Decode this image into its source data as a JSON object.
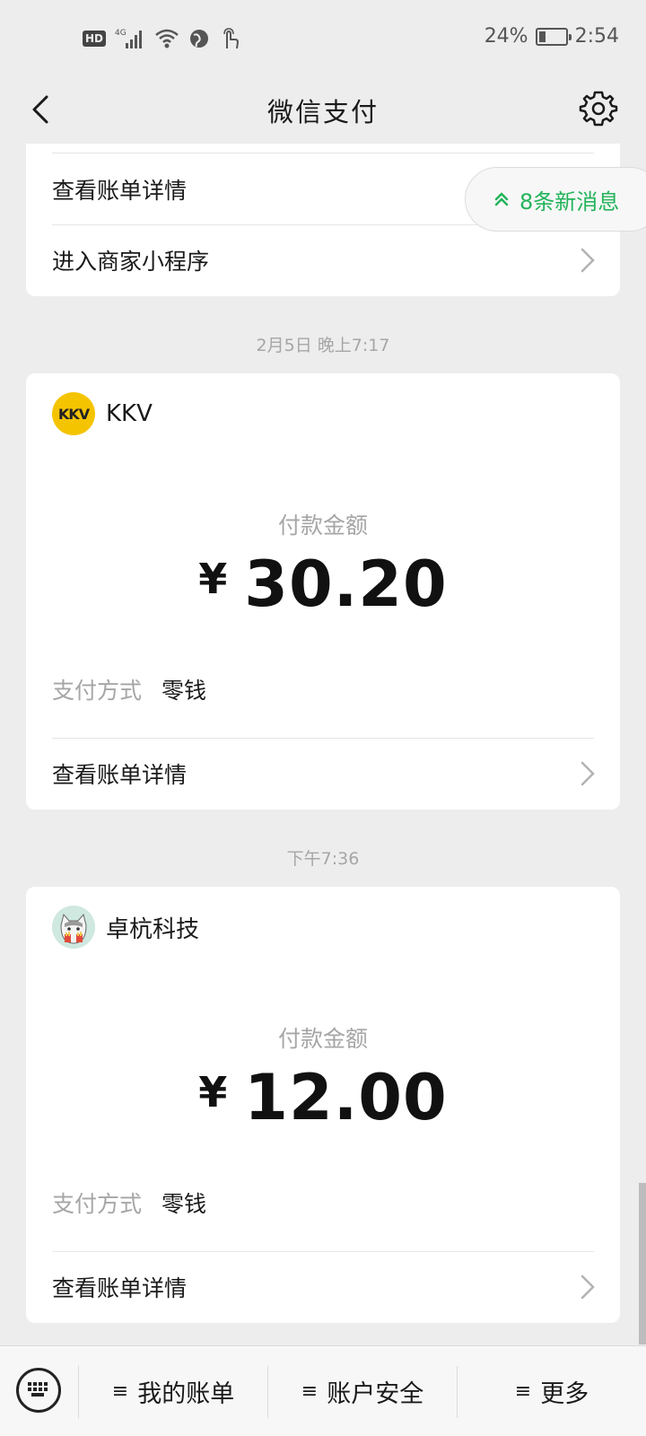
{
  "status_bar": {
    "hd": "HD",
    "network": "4G",
    "battery_text": "24%",
    "battery_level": 0.24,
    "time": "2:54"
  },
  "nav": {
    "title": "微信支付"
  },
  "top_card": {
    "rows": [
      {
        "label": "查看账单详情"
      },
      {
        "label": "进入商家小程序"
      }
    ]
  },
  "new_messages": {
    "label": "8条新消息"
  },
  "transactions": [
    {
      "time_label": "2月5日 晚上7:17",
      "merchant": "KKV",
      "logo_text": "KKV",
      "amount_label": "付款金额",
      "currency": "¥",
      "amount": "30.20",
      "pay_method_key": "支付方式",
      "pay_method_value": "零钱",
      "details_label": "查看账单详情"
    },
    {
      "time_label": "下午7:36",
      "merchant": "卓杭科技",
      "amount_label": "付款金额",
      "currency": "¥",
      "amount": "12.00",
      "pay_method_key": "支付方式",
      "pay_method_value": "零钱",
      "details_label": "查看账单详情"
    }
  ],
  "bottom_menu": {
    "items": [
      {
        "label": "我的账单"
      },
      {
        "label": "账户安全"
      },
      {
        "label": "更多"
      }
    ]
  },
  "colors": {
    "accent_green": "#23b35a",
    "kkv_yellow": "#f5c400",
    "background": "#ededed"
  }
}
